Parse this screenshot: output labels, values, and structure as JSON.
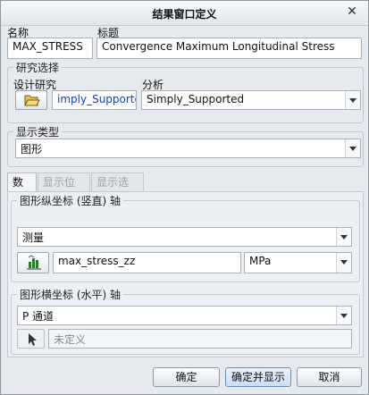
{
  "window": {
    "title": "结果窗口定义"
  },
  "name_field": {
    "label": "名称",
    "value": "MAX_STRESS"
  },
  "title_field": {
    "label": "标题",
    "value": "Convergence Maximum Longitudinal Stress"
  },
  "study_section": {
    "legend": "研究选择",
    "design_study_label": "设计研究",
    "design_study_value": "imply_Supported",
    "analysis_label": "分析",
    "analysis_value": "Simply_Supported"
  },
  "display_type_section": {
    "legend": "显示类型",
    "value": "图形"
  },
  "tabs": [
    {
      "label": "数量",
      "active": true
    },
    {
      "label": "显示位置",
      "active": false
    },
    {
      "label": "显示选项",
      "active": false
    }
  ],
  "y_axis_section": {
    "legend": "图形纵坐标 (竖直) 轴",
    "quantity_value": "测量",
    "measure_value": "max_stress_zz",
    "unit_value": "MPa"
  },
  "x_axis_section": {
    "legend": "图形横坐标 (水平) 轴",
    "pass_value": "P 通道",
    "undefined_placeholder": "未定义"
  },
  "buttons": {
    "ok": "确定",
    "ok_show": "确定并显示",
    "cancel": "取消"
  },
  "icons": [
    "close-icon",
    "folder-open-icon",
    "measure-icon",
    "select-arrow-icon",
    "chevron-down-icon"
  ],
  "colors": {
    "selected_text": "#1a3fb0",
    "primary_button": "#c9def5"
  }
}
